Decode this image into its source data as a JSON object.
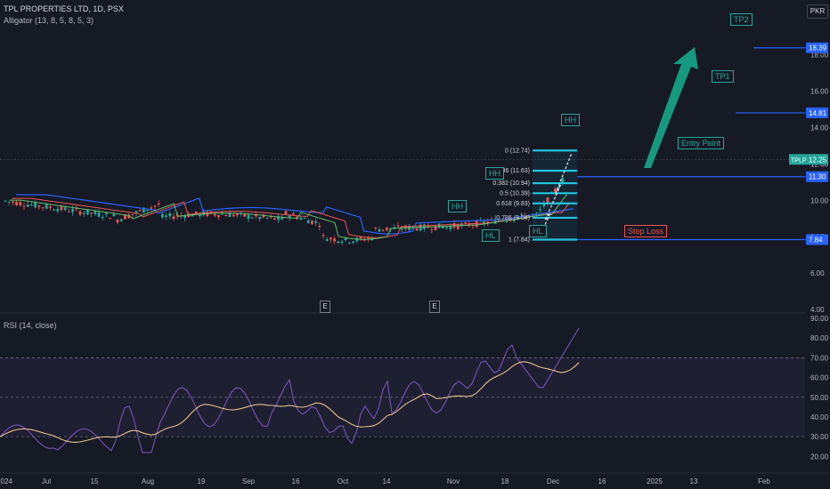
{
  "header": {
    "symbol_line": "TPL PROPERTIES LTD, 1D, PSX",
    "indicator_line": "Alligator (13, 8, 5, 8, 5, 3)",
    "currency": "PKR"
  },
  "rsi": {
    "title": "RSI (14, close)"
  },
  "price_axis": {
    "ticks": [
      "18.00",
      "16.00",
      "14.00",
      "12.00",
      "10.00",
      "8.00",
      "6.00",
      "4.00"
    ]
  },
  "rsi_axis": {
    "ticks": [
      "90.00",
      "80.00",
      "70.00",
      "60.00",
      "50.00",
      "40.00",
      "30.00",
      "20.00"
    ]
  },
  "time_axis": {
    "ticks": [
      "2024",
      "Jul",
      "15",
      "Aug",
      "19",
      "Sep",
      "16",
      "Oct",
      "14",
      "Nov",
      "18",
      "Dec",
      "16",
      "2025",
      "13",
      "Feb"
    ]
  },
  "price_labels": [
    {
      "text": "18.39",
      "level": 18.39
    },
    {
      "text": "14.81",
      "level": 14.81
    },
    {
      "text": "12.25",
      "level": 12.25,
      "symbol": "TPLP"
    },
    {
      "text": "11.30",
      "level": 11.3
    },
    {
      "text": "7.84",
      "level": 7.84
    }
  ],
  "annotations": {
    "tp2": "TP2",
    "tp1": "TP1",
    "entry": "Entry Point",
    "stop": "Stop Loss",
    "hh1": "HH",
    "hh2": "HH",
    "hh3": "HH",
    "hl1": "HL",
    "hl2": "HL",
    "e1": "E",
    "e2": "E"
  },
  "fib_levels": [
    "0 (12.74)",
    "0.236 (11.63)",
    "0.382 (10.94)",
    "0.5 (10.39)",
    "0.618 (9.83)",
    "0.786 (9.04)",
    "1 (7.84)"
  ],
  "colors": {
    "background": "#161a25",
    "bull": "#26a69a",
    "bear": "#ef5350",
    "line_blue": "#2962ff",
    "rsi_line": "#7e57c2",
    "rsi_ma": "#e3c18a",
    "fib": "#22c4e0",
    "arrow": "#159a80"
  }
}
